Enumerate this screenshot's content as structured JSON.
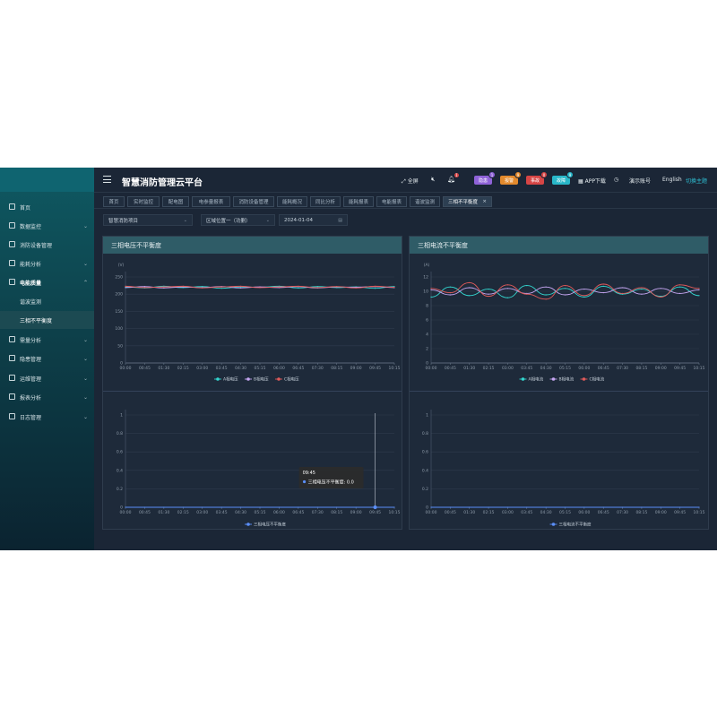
{
  "app": {
    "title": "智慧消防管理云平台"
  },
  "header": {
    "fullscreen_label": "全屏",
    "bell_count": "1",
    "badges": [
      {
        "label": "隐患",
        "count": "1",
        "color": "#8f63d8"
      },
      {
        "label": "报警",
        "count": "9",
        "color": "#e38a2d"
      },
      {
        "label": "事故",
        "count": "0",
        "color": "#d64545"
      },
      {
        "label": "故障",
        "count": "9",
        "color": "#29b7c9"
      }
    ],
    "app_download": "APP下载",
    "account": "演示账号",
    "language": "English",
    "theme_switch": "切换主题"
  },
  "sidebar": {
    "items": [
      {
        "label": "首页",
        "chevron": ""
      },
      {
        "label": "数据监控",
        "chevron": "⌄"
      },
      {
        "label": "消防设备管理",
        "chevron": ""
      },
      {
        "label": "能耗分析",
        "chevron": "⌄"
      },
      {
        "label": "电能质量",
        "chevron": "⌃"
      },
      {
        "label": "谐波监测",
        "chevron": ""
      },
      {
        "label": "三相不平衡度",
        "chevron": ""
      },
      {
        "label": "需量分析",
        "chevron": "⌄"
      },
      {
        "label": "隐患管理",
        "chevron": "⌄"
      },
      {
        "label": "运维管理",
        "chevron": "⌄"
      },
      {
        "label": "报表分析",
        "chevron": "⌄"
      },
      {
        "label": "日志管理",
        "chevron": "⌄"
      }
    ]
  },
  "tabs": [
    "首页",
    "实时监控",
    "配电图",
    "电参量报表",
    "消防设备管理",
    "能耗概况",
    "同比分析",
    "能耗报表",
    "电能报表",
    "谐波监测",
    "三相不平衡度"
  ],
  "tab_close": "×",
  "filters": {
    "project": "智慧消防项目",
    "area": "区域位置一（功删）",
    "date": "2024-01-04"
  },
  "panels": {
    "voltage_title": "三相电压不平衡度",
    "current_title": "三相电流不平衡度"
  },
  "chart_data": [
    {
      "type": "line",
      "ylabel": "(V)",
      "ylim": [
        0,
        250
      ],
      "yticks": [
        0,
        50,
        100,
        150,
        200,
        250
      ],
      "categories": [
        "00:00",
        "00:45",
        "01:30",
        "02:15",
        "03:00",
        "03:45",
        "04:30",
        "05:15",
        "06:00",
        "06:45",
        "07:30",
        "08:15",
        "09:00",
        "09:45",
        "10:15"
      ],
      "series": [
        {
          "name": "A相电压",
          "color": "#33d6cf",
          "values": [
            221,
            218,
            223,
            219,
            222,
            217,
            221,
            220,
            223,
            218,
            222,
            219,
            221,
            217,
            222
          ]
        },
        {
          "name": "B相电压",
          "color": "#c6a6f2",
          "values": [
            219,
            222,
            218,
            221,
            219,
            222,
            218,
            221,
            219,
            222,
            218,
            221,
            220,
            222,
            219
          ]
        },
        {
          "name": "C相电压",
          "color": "#e05a5a",
          "values": [
            223,
            219,
            221,
            223,
            218,
            221,
            223,
            219,
            221,
            223,
            219,
            222,
            218,
            223,
            220
          ]
        }
      ],
      "legend": "bottom"
    },
    {
      "type": "line",
      "ylabel": "(A)",
      "ylim": [
        0,
        12
      ],
      "yticks": [
        0,
        2,
        4,
        6,
        8,
        10,
        12
      ],
      "categories": [
        "00:00",
        "00:45",
        "01:30",
        "02:15",
        "03:00",
        "03:45",
        "04:30",
        "05:15",
        "06:00",
        "06:45",
        "07:30",
        "08:15",
        "09:00",
        "09:45",
        "10:15"
      ],
      "series": [
        {
          "name": "A相电流",
          "color": "#33d6cf",
          "values": [
            9.2,
            10.6,
            9.4,
            10.3,
            9.1,
            10.8,
            9.5,
            10.4,
            9.2,
            10.7,
            9.6,
            10.3,
            9.3,
            10.6,
            9.4
          ]
        },
        {
          "name": "B相电流",
          "color": "#c6a6f2",
          "values": [
            10.2,
            9.5,
            10.5,
            9.6,
            10.4,
            9.7,
            10.6,
            9.5,
            10.3,
            9.8,
            10.5,
            9.6,
            10.4,
            9.7,
            10.2
          ]
        },
        {
          "name": "C相电流",
          "color": "#e05a5a",
          "values": [
            10.4,
            9.8,
            11.2,
            9.3,
            10.9,
            9.6,
            8.9,
            10.8,
            9.4,
            11.0,
            9.7,
            10.5,
            9.2,
            10.9,
            10.4
          ]
        }
      ],
      "legend": "bottom"
    },
    {
      "type": "line",
      "ylim": [
        0,
        1
      ],
      "yticks": [
        0,
        0.2,
        0.4,
        0.6,
        0.8,
        1
      ],
      "categories": [
        "00:00",
        "00:45",
        "01:30",
        "02:15",
        "03:00",
        "03:45",
        "04:30",
        "05:15",
        "06:00",
        "06:45",
        "07:30",
        "08:15",
        "09:00",
        "09:45",
        "10:15"
      ],
      "series": [
        {
          "name": "三相电压不平衡度",
          "color": "#5b8ff9",
          "values": [
            0,
            0,
            0,
            0,
            0,
            0,
            0,
            0,
            0,
            0,
            0,
            0,
            0,
            0,
            0
          ]
        }
      ],
      "tooltip": {
        "time": "09:45",
        "label": "三相电压不平衡度: 0.0"
      },
      "legend": "bottom"
    },
    {
      "type": "line",
      "ylim": [
        0,
        1
      ],
      "yticks": [
        0,
        0.2,
        0.4,
        0.6,
        0.8,
        1
      ],
      "categories": [
        "00:00",
        "00:45",
        "01:30",
        "02:15",
        "03:00",
        "03:45",
        "04:30",
        "05:15",
        "06:00",
        "06:45",
        "07:30",
        "08:15",
        "09:00",
        "09:45",
        "10:15"
      ],
      "series": [
        {
          "name": "三相电流不平衡度",
          "color": "#5b8ff9",
          "values": [
            0,
            0,
            0,
            0,
            0,
            0,
            0,
            0,
            0,
            0,
            0,
            0,
            0,
            0,
            0
          ]
        }
      ],
      "legend": "bottom"
    }
  ]
}
